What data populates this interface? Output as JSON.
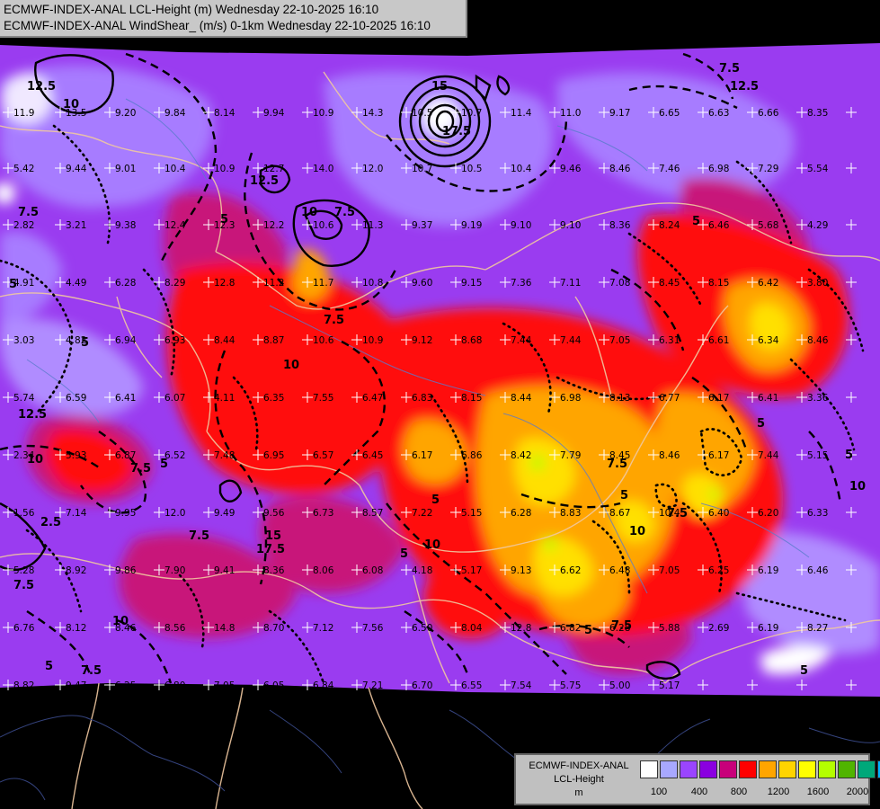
{
  "title": {
    "line1": "ECMWF-INDEX-ANAL LCL-Height (m) Wednesday 22-10-2025 16:10",
    "line2": "ECMWF-INDEX-ANAL WindShear_ (m/s) 0-1km Wednesday 22-10-2025 16:10"
  },
  "legend": {
    "line1": "ECMWF-INDEX-ANAL",
    "line2": "LCL-Height",
    "line3": "m",
    "colors": [
      "#ffffff",
      "#a8a8ff",
      "#9a45ff",
      "#8a00e0",
      "#c8007a",
      "#ff0000",
      "#ffa500",
      "#ffd400",
      "#ffff00",
      "#b4ff00",
      "#50b400",
      "#00a87a",
      "#00b4ff"
    ],
    "ticks": [
      "100",
      "400",
      "800",
      "1200",
      "1600",
      "2000"
    ]
  },
  "map": {
    "background_color": "#9a3cf0",
    "no_data_color": "#000000",
    "contour_labels": [
      "12.5",
      "10",
      "7.5",
      "5",
      "15",
      "17.5",
      "12.5",
      "10",
      "7.5",
      "5",
      "10",
      "7.5",
      "5",
      "12.5",
      "10",
      "7.5",
      "5",
      "15",
      "17.5",
      "7.5",
      "5",
      "10",
      "5",
      "7.5",
      "5",
      "7.5",
      "5",
      "10",
      "7.5",
      "5",
      "12.5",
      "7.5",
      "5",
      "10",
      "5",
      "2.5",
      "7.5",
      "5",
      "10",
      "7.5",
      "5"
    ],
    "values": [
      "11.9",
      "13.5",
      "9.20",
      "9.84",
      "8.14",
      "9.94",
      "10.9",
      "14.3",
      "10.5",
      "10.7",
      "11.4",
      "11.0",
      "9.17",
      "6.65",
      "6.63",
      "6.66",
      "8.35",
      "5.42",
      "9.44",
      "9.01",
      "10.4",
      "10.9",
      "12.7",
      "14.0",
      "12.0",
      "10.7",
      "10.5",
      "10.4",
      "9.46",
      "8.46",
      "7.46",
      "6.98",
      "7.29",
      "5.54",
      "2.82",
      "3.21",
      "9.38",
      "12.4",
      "12.3",
      "12.2",
      "10.6",
      "11.3",
      "9.37",
      "9.19",
      "9.10",
      "9.10",
      "8.36",
      "8.24",
      "6.46",
      "5.68",
      "4.29",
      "4.91",
      "4.49",
      "6.28",
      "8.29",
      "12.8",
      "11.2",
      "11.7",
      "10.8",
      "9.60",
      "9.15",
      "7.36",
      "7.11",
      "7.08",
      "8.45",
      "8.15",
      "6.42",
      "3.80",
      "3.03",
      "4.82",
      "6.94",
      "6.93",
      "8.44",
      "8.87",
      "10.6",
      "10.9",
      "9.12",
      "8.68",
      "7.44",
      "7.44",
      "7.05",
      "6.31",
      "6.61",
      "6.34",
      "8.46",
      "5.74",
      "6.59",
      "6.41",
      "6.07",
      "4.11",
      "6.35",
      "7.55",
      "6.47",
      "6.83",
      "8.15",
      "8.44",
      "6.98",
      "8.13",
      "6.77",
      "6.17",
      "6.41",
      "3.36",
      "2.34",
      "5.93",
      "6.87",
      "6.52",
      "7.48",
      "6.95",
      "6.57",
      "6.45",
      "6.17",
      "6.86",
      "8.42",
      "7.79",
      "8.45",
      "8.46",
      "6.17",
      "7.44",
      "5.15",
      "1.56",
      "7.14",
      "9.95",
      "12.0",
      "9.49",
      "9.56",
      "6.73",
      "8.57",
      "7.22",
      "5.15",
      "6.28",
      "8.83",
      "8.67",
      "10.4",
      "6.40",
      "6.20",
      "6.33",
      "5.28",
      "8.92",
      "9.86",
      "7.90",
      "9.41",
      "8.36",
      "8.06",
      "6.08",
      "4.18",
      "5.17",
      "9.13",
      "6.62",
      "6.48",
      "7.05",
      "6.25",
      "6.19",
      "6.46",
      "6.76",
      "8.12",
      "8.46",
      "8.56",
      "14.8",
      "8.70",
      "7.12",
      "7.56",
      "6.50",
      "8.04",
      "12.8",
      "6.82",
      "6.28",
      "5.88",
      "2.69",
      "6.19",
      "8.27",
      "8.82",
      "9.47",
      "6.25",
      "6.80",
      "7.05",
      "6.05",
      "6.84",
      "7.21",
      "6.70",
      "6.55",
      "7.54",
      "5.75",
      "5.00",
      "5.17"
    ]
  }
}
